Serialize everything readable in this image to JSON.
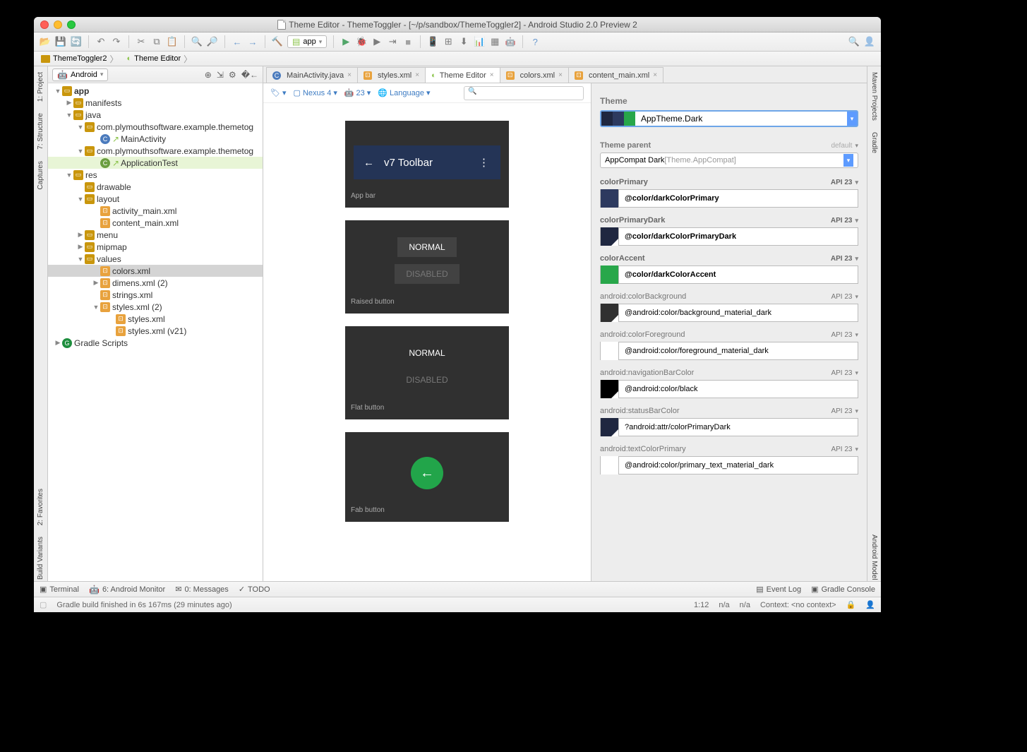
{
  "window": {
    "title": "Theme Editor - ThemeToggler - [~/p/sandbox/ThemeToggler2] - Android Studio 2.0 Preview 2"
  },
  "breadcrumbs": {
    "project": "ThemeToggler2",
    "editor": "Theme Editor"
  },
  "toolbar": {
    "module": "app"
  },
  "project_view": {
    "mode": "Android"
  },
  "tree": {
    "app": "app",
    "manifests": "manifests",
    "java": "java",
    "pkg1": "com.plymouthsoftware.example.themetog",
    "mainactivity": "MainActivity",
    "pkg2": "com.plymouthsoftware.example.themetog",
    "apptest": "ApplicationTest",
    "res": "res",
    "drawable": "drawable",
    "layout": "layout",
    "activity_main": "activity_main.xml",
    "content_main": "content_main.xml",
    "menu": "menu",
    "mipmap": "mipmap",
    "values": "values",
    "colors": "colors.xml",
    "dimens": "dimens.xml  (2)",
    "strings": "strings.xml",
    "styles": "styles.xml  (2)",
    "styles1": "styles.xml",
    "styles2": "styles.xml  (v21)",
    "gradle": "Gradle Scripts"
  },
  "tabs": {
    "t0": "MainActivity.java",
    "t1": "styles.xml",
    "t2": "Theme Editor",
    "t3": "colors.xml",
    "t4": "content_main.xml"
  },
  "preview_toolbar": {
    "device": "Nexus 4",
    "api": "23",
    "lang": "Language"
  },
  "preview": {
    "appbar_title": "v7 Toolbar",
    "appbar_label": "App bar",
    "normal": "NORMAL",
    "disabled": "DISABLED",
    "raised_label": "Raised button",
    "flat_label": "Flat button",
    "fab_label": "Fab button"
  },
  "theme": {
    "heading": "Theme",
    "name": "AppTheme.Dark",
    "parent_heading": "Theme parent",
    "parent_default": "default",
    "parent_name": "AppCompat Dark ",
    "parent_detail": "[Theme.AppCompat]"
  },
  "attrs": [
    {
      "label": "colorPrimary",
      "bold": true,
      "api": "API 23",
      "color": "#2d3a5f",
      "value": "@color/darkColorPrimary",
      "diag": false
    },
    {
      "label": "colorPrimaryDark",
      "bold": true,
      "api": "API 23",
      "color": "#1f2740",
      "value": "@color/darkColorPrimaryDark",
      "diag": true
    },
    {
      "label": "colorAccent",
      "bold": true,
      "api": "API 23",
      "color": "#28a74a",
      "value": "@color/darkColorAccent",
      "diag": false
    },
    {
      "label": "android:colorBackground",
      "bold": false,
      "api": "API 23",
      "color": "#303030",
      "value": "@android:color/background_material_dark",
      "diag": true
    },
    {
      "label": "android:colorForeground",
      "bold": false,
      "api": "API 23",
      "color": "#ffffff",
      "value": "@android:color/foreground_material_dark",
      "diag": true
    },
    {
      "label": "android:navigationBarColor",
      "bold": false,
      "api": "API 23",
      "color": "#000000",
      "value": "@android:color/black",
      "diag": true
    },
    {
      "label": "android:statusBarColor",
      "bold": false,
      "api": "API 23",
      "color": "#1f2740",
      "value": "?android:attr/colorPrimaryDark",
      "diag": true
    },
    {
      "label": "android:textColorPrimary",
      "bold": false,
      "api": "API 23",
      "color": "#ffffff",
      "value": "@android:color/primary_text_material_dark",
      "diag": false
    }
  ],
  "bottom": {
    "terminal": "Terminal",
    "monitor": "6: Android Monitor",
    "messages": "0: Messages",
    "todo": "TODO",
    "eventlog": "Event Log",
    "gradlecon": "Gradle Console"
  },
  "status": {
    "msg": "Gradle build finished in 6s 167ms (29 minutes ago)",
    "pos": "1:12",
    "na1": "n/a",
    "na2": "n/a",
    "ctx": "Context: <no context>"
  },
  "side": {
    "project": "1: Project",
    "structure": "7: Structure",
    "captures": "Captures",
    "fav": "2: Favorites",
    "buildvar": "Build Variants",
    "maven": "Maven Projects",
    "gradle": "Gradle",
    "andmodel": "Android Model"
  }
}
